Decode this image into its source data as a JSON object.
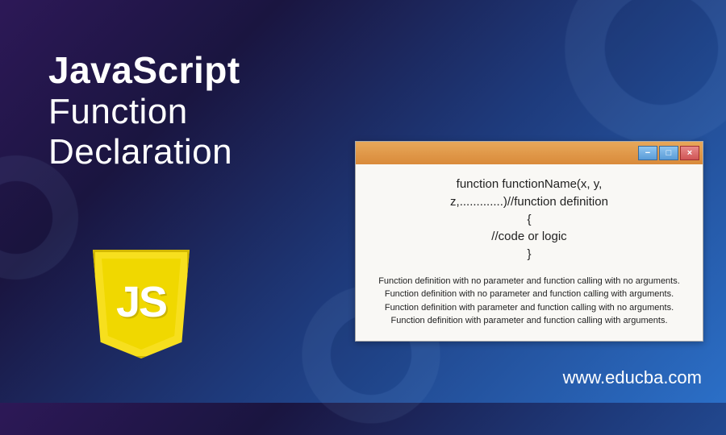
{
  "title": {
    "line1": "JavaScript",
    "line2": "Function",
    "line3": "Declaration"
  },
  "logo": {
    "text": "JS"
  },
  "window": {
    "buttons": {
      "minimize": "−",
      "maximize": "□",
      "close": "×"
    },
    "code": {
      "line1": "function functionName(x, y,",
      "line2": "z,.............)//function definition",
      "line3": "{",
      "line4": "//code or logic",
      "line5": "}"
    },
    "description": {
      "line1": "Function definition with no parameter and function calling with no arguments.",
      "line2": "Function definition with no parameter and function calling with arguments.",
      "line3": "Function definition with parameter and function calling with no arguments.",
      "line4": "Function definition with parameter and function calling with arguments."
    }
  },
  "footer": {
    "url": "www.educba.com"
  }
}
